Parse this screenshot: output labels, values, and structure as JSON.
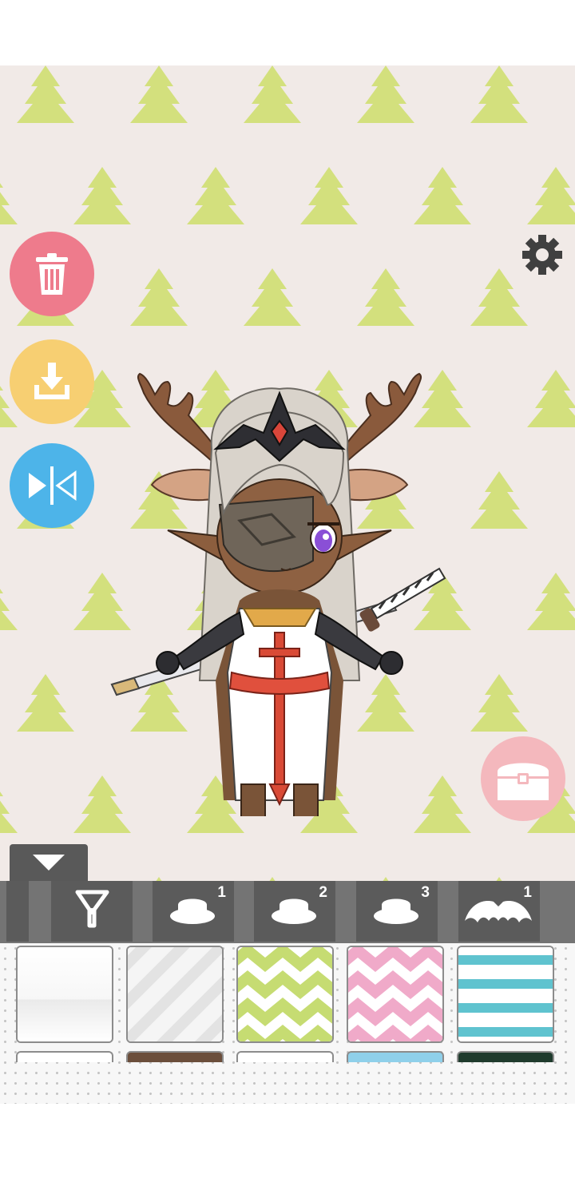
{
  "app": {
    "screen": "avatar-maker-editor"
  },
  "background_pattern": {
    "name": "tree-pattern",
    "base_color": "#f1eae7",
    "tree_color": "#d3e07d"
  },
  "left_actions": [
    {
      "name": "delete",
      "icon": "trash-icon",
      "color": "#ee7b8c"
    },
    {
      "name": "save",
      "icon": "download-icon",
      "color": "#f7cf72"
    },
    {
      "name": "flip",
      "icon": "flip-horizontal-icon",
      "color": "#4db4e9"
    }
  ],
  "settings": {
    "icon": "gear-icon"
  },
  "gacha": {
    "icon": "treasure-chest-icon",
    "color": "#f4b8bd"
  },
  "character": {
    "description_icon": "chibi-character-preview"
  },
  "panel": {
    "collapse_icon": "triangle-down-icon",
    "tabs": [
      {
        "icon": "background-frame-icon",
        "badge": ""
      },
      {
        "icon": "hat-icon",
        "badge": "1"
      },
      {
        "icon": "hat-icon",
        "badge": "2"
      },
      {
        "icon": "hat-icon",
        "badge": "3"
      },
      {
        "icon": "bat-wings-icon",
        "badge": "1"
      }
    ],
    "swatches": [
      {
        "pattern": "plain-white"
      },
      {
        "pattern": "white-diagonal-stripes"
      },
      {
        "pattern": "green-zigzag"
      },
      {
        "pattern": "pink-zigzag"
      },
      {
        "pattern": "teal-horizontal-stripes"
      }
    ]
  }
}
